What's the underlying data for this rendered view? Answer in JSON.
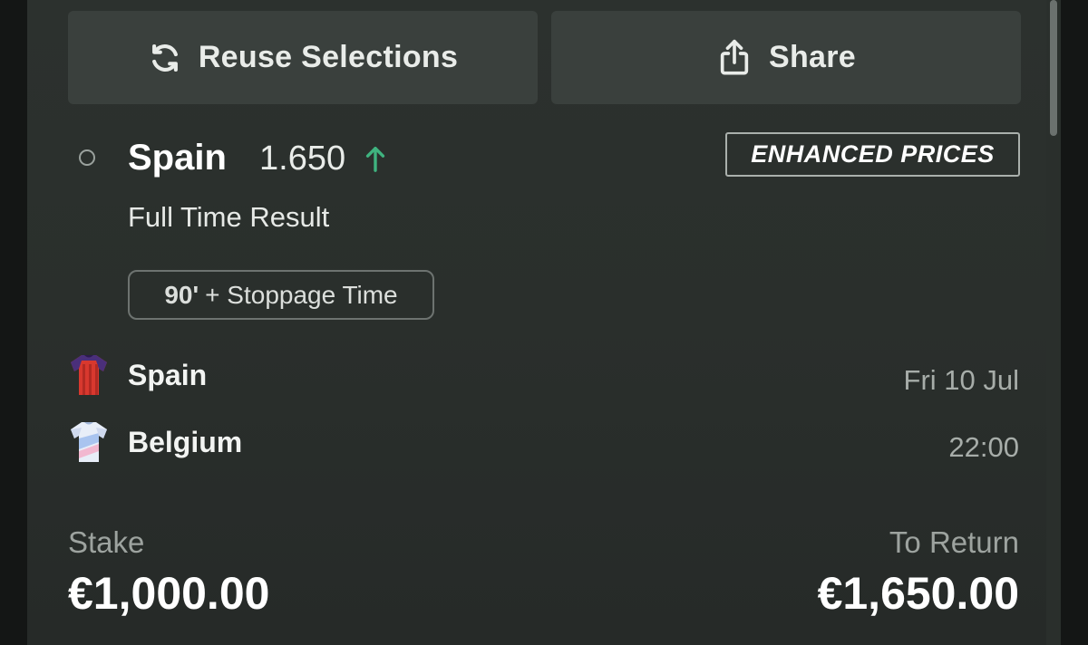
{
  "actions": {
    "reuse_label": "Reuse Selections",
    "share_label": "Share"
  },
  "selection": {
    "team": "Spain",
    "odds": "1.650",
    "odds_trend": "up",
    "badge": "ENHANCED PRICES",
    "market": "Full Time Result",
    "period_bold": "90'",
    "period_rest": "+ Stoppage Time"
  },
  "match": {
    "home_team": "Spain",
    "away_team": "Belgium",
    "date": "Fri 10 Jul",
    "time": "22:00"
  },
  "bet": {
    "stake_label": "Stake",
    "stake_value": "€1,000.00",
    "return_label": "To Return",
    "return_value": "€1,650.00"
  },
  "colors": {
    "background": "#2a2f2c",
    "button": "#3a403d",
    "accent_up": "#3fb37f"
  },
  "icons": [
    "refresh-icon",
    "share-icon",
    "arrow-up-icon",
    "spain-shirt-icon",
    "belgium-shirt-icon"
  ]
}
